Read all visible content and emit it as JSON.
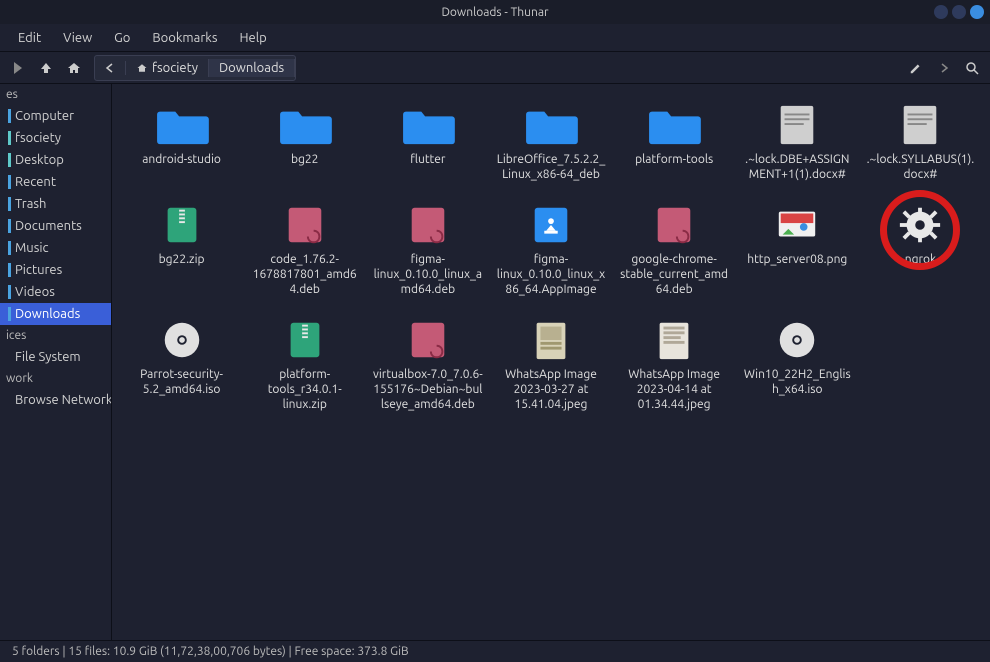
{
  "window": {
    "title": "Downloads - Thunar"
  },
  "menu": {
    "edit": "Edit",
    "view": "View",
    "go": "Go",
    "bookmarks": "Bookmarks",
    "help": "Help"
  },
  "path": {
    "parent": "fsociety",
    "current": "Downloads"
  },
  "sidebar": {
    "sections": {
      "places_head": "es",
      "devices_head": "ices",
      "network_head": "work"
    },
    "places": [
      {
        "label": "Computer",
        "accent": "blue"
      },
      {
        "label": "fsociety",
        "accent": "cyan"
      },
      {
        "label": "Desktop",
        "accent": "cyan"
      },
      {
        "label": "Recent",
        "accent": "blue"
      },
      {
        "label": "Trash",
        "accent": "blue"
      },
      {
        "label": "Documents",
        "accent": "blue"
      },
      {
        "label": "Music",
        "accent": "blue"
      },
      {
        "label": "Pictures",
        "accent": "blue"
      },
      {
        "label": "Videos",
        "accent": "blue"
      },
      {
        "label": "Downloads",
        "accent": "blue",
        "selected": true
      }
    ],
    "devices": [
      {
        "label": "File System",
        "accent": "none"
      }
    ],
    "network": [
      {
        "label": "Browse Network",
        "accent": "none"
      }
    ]
  },
  "files": [
    {
      "label": "android-studio",
      "type": "folder"
    },
    {
      "label": "bg22",
      "type": "folder"
    },
    {
      "label": "flutter",
      "type": "folder"
    },
    {
      "label": "LibreOffice_7.5.2.2_Linux_x86-64_deb",
      "type": "folder"
    },
    {
      "label": "platform-tools",
      "type": "folder"
    },
    {
      "label": ".~lock.DBE+ASSIGNMENT+1(1).docx#",
      "type": "doc"
    },
    {
      "label": ".~lock.SYLLABUS(1).docx#",
      "type": "doc"
    },
    {
      "label": "bg22.zip",
      "type": "zip"
    },
    {
      "label": "code_1.76.2-1678817801_amd64.deb",
      "type": "deb"
    },
    {
      "label": "figma-linux_0.10.0_linux_amd64.deb",
      "type": "deb"
    },
    {
      "label": "figma-linux_0.10.0_linux_x86_64.AppImage",
      "type": "appimage"
    },
    {
      "label": "google-chrome-stable_current_amd64.deb",
      "type": "deb"
    },
    {
      "label": "http_server08.png",
      "type": "png"
    },
    {
      "label": "ngrok",
      "type": "exec",
      "highlight": true
    },
    {
      "label": "Parrot-security-5.2_amd64.iso",
      "type": "iso"
    },
    {
      "label": "platform-tools_r34.0.1-linux.zip",
      "type": "zip"
    },
    {
      "label": "virtualbox-7.0_7.0.6-155176~Debian~bullseye_amd64.deb",
      "type": "deb"
    },
    {
      "label": "WhatsApp Image 2023-03-27 at 15.41.04.jpeg",
      "type": "jpeg1"
    },
    {
      "label": "WhatsApp Image 2023-04-14 at 01.34.44.jpeg",
      "type": "jpeg2"
    },
    {
      "label": "Win10_22H2_English_x64.iso",
      "type": "iso"
    }
  ],
  "status": {
    "text": "5 folders  |  15 files: 10.9 GiB (11,72,38,00,706 bytes)  |  Free space: 373.8 GiB"
  }
}
